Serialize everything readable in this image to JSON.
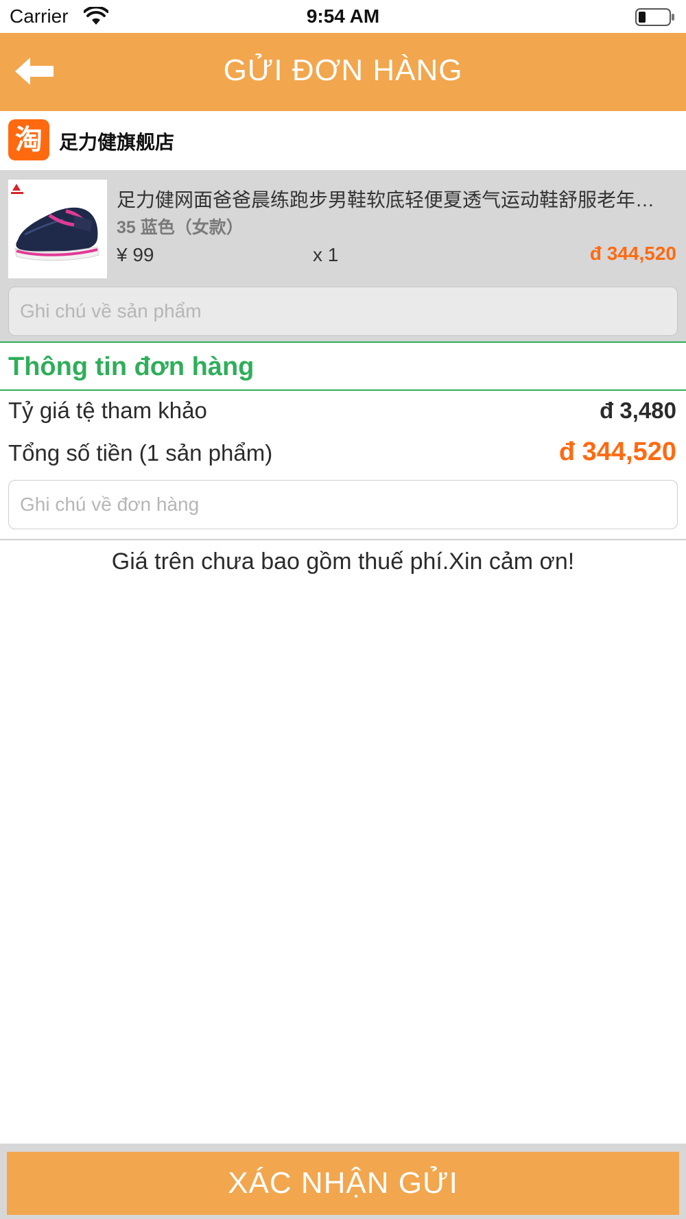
{
  "status_bar": {
    "carrier": "Carrier",
    "time": "9:54 AM",
    "wifi_icon": "wifi-icon",
    "battery_icon": "battery-icon"
  },
  "header": {
    "title": "GỬI ĐƠN HÀNG",
    "back_icon": "back-arrow-icon",
    "background_color": "#F2A64D"
  },
  "shop": {
    "logo_icon": "taobao-logo",
    "name": "足力健旗舰店"
  },
  "product": {
    "title": "足力健网面爸爸晨练跑步男鞋软底轻便夏透气运动鞋舒服老年…",
    "variant": "35 蓝色（女款）",
    "unit_price": "¥ 99",
    "quantity": "x 1",
    "total": "đ 344,520",
    "note_placeholder": "Ghi chú về sản phẩm"
  },
  "order_info": {
    "section_title": "Thông tin đơn hàng",
    "exchange_rate_label": "Tỷ giá tệ tham khảo",
    "exchange_rate_value": "đ 3,480",
    "total_label": "Tổng số tiền (1 sản phẩm)",
    "total_value": "đ 344,520",
    "note_placeholder": "Ghi chú về đơn hàng"
  },
  "disclaimer": "Giá trên chưa bao gồm thuế phí.Xin cảm ơn!",
  "confirm_button_label": "XÁC NHẬN GỬI",
  "colors": {
    "accent": "#F2A64D",
    "section_green": "#2FAE5A",
    "price_orange": "#FF6A10"
  }
}
